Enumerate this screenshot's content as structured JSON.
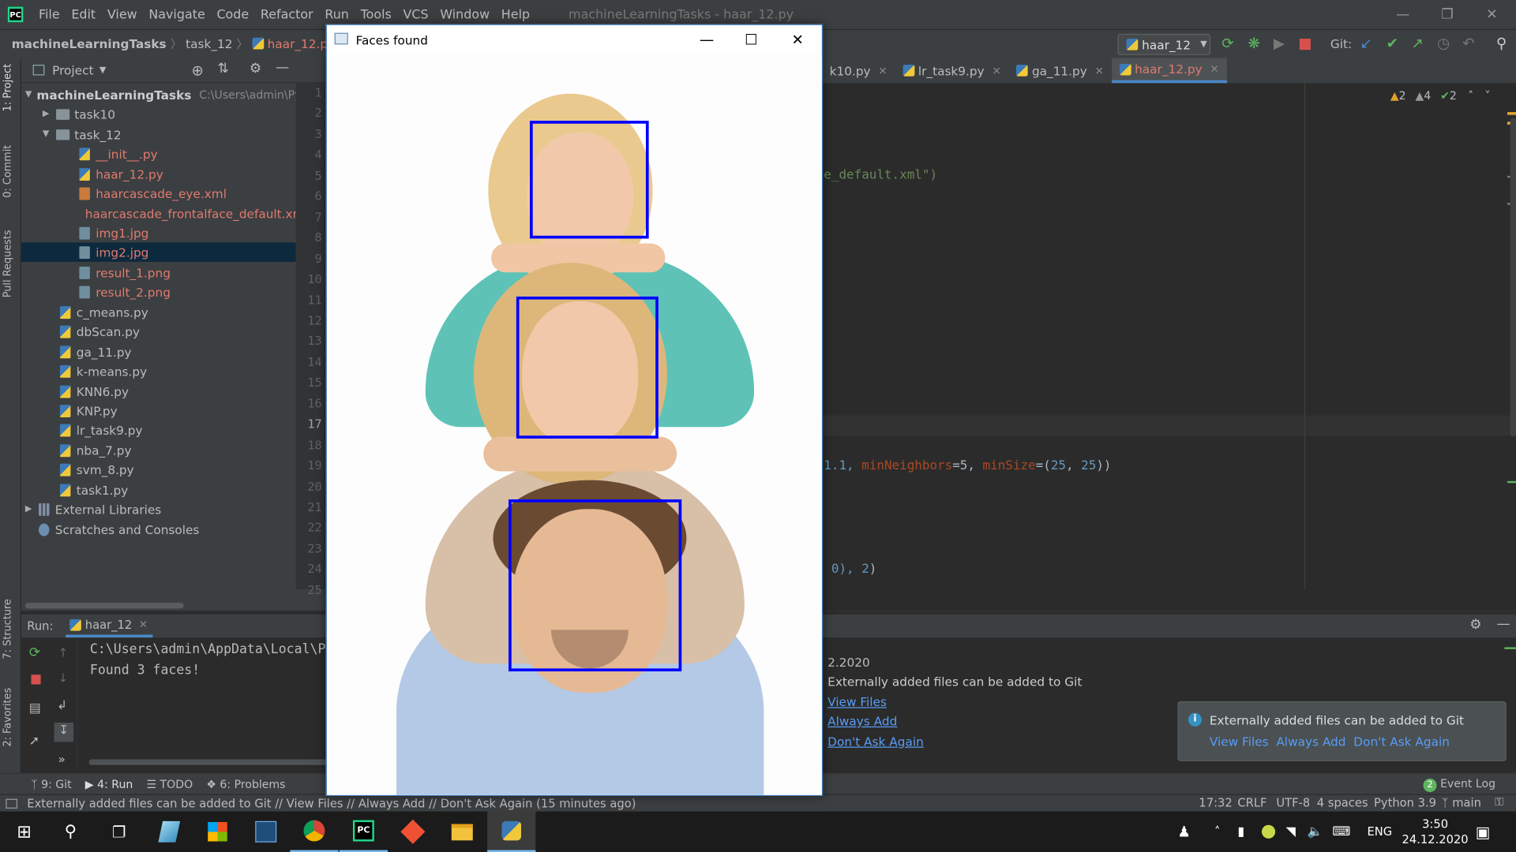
{
  "window": {
    "title": "machineLearningTasks - haar_12.py"
  },
  "menu": [
    "File",
    "Edit",
    "View",
    "Navigate",
    "Code",
    "Refactor",
    "Run",
    "Tools",
    "VCS",
    "Window",
    "Help"
  ],
  "breadcrumb": {
    "project": "machineLearningTasks",
    "folder": "task_12",
    "file": "haar_12.py"
  },
  "toolbar": {
    "run_config": "haar_12",
    "git_label": "Git:"
  },
  "project_panel": {
    "title": "Project",
    "root_name": "machineLearningTasks",
    "root_path": "C:\\Users\\admin\\Pych",
    "items": [
      {
        "name": "task10"
      },
      {
        "name": "task_12"
      },
      {
        "name": "__init__.py"
      },
      {
        "name": "haar_12.py"
      },
      {
        "name": "haarcascade_eye.xml"
      },
      {
        "name": "haarcascade_frontalface_default.xml"
      },
      {
        "name": "img1.jpg"
      },
      {
        "name": "img2.jpg"
      },
      {
        "name": "result_1.png"
      },
      {
        "name": "result_2.png"
      },
      {
        "name": "c_means.py"
      },
      {
        "name": "dbScan.py"
      },
      {
        "name": "ga_11.py"
      },
      {
        "name": "k-means.py"
      },
      {
        "name": "KNN6.py"
      },
      {
        "name": "KNP.py"
      },
      {
        "name": "lr_task9.py"
      },
      {
        "name": "nba_7.py"
      },
      {
        "name": "svm_8.py"
      },
      {
        "name": "task1.py"
      },
      {
        "name": "External Libraries"
      },
      {
        "name": "Scratches and Consoles"
      }
    ]
  },
  "side_tabs": [
    "1: Project",
    "0: Commit",
    "Pull Requests",
    "7: Structure",
    "2: Favorites"
  ],
  "editor_tabs": [
    {
      "label": "k10.py"
    },
    {
      "label": "lr_task9.py"
    },
    {
      "label": "ga_11.py"
    },
    {
      "label": "haar_12.py"
    }
  ],
  "line_numbers": [
    "1",
    "2",
    "3",
    "4",
    "5",
    "6",
    "7",
    "8",
    "9",
    "10",
    "11",
    "12",
    "13",
    "14",
    "15",
    "16",
    "17",
    "18",
    "19",
    "20",
    "21",
    "22",
    "23",
    "24",
    "25"
  ],
  "inspections": {
    "warnings": "2",
    "weak_warnings": "4",
    "ok": "2"
  },
  "code": {
    "line5": "e_default.xml\")",
    "line19_a": "1.1, ",
    "line19_b": "minNeighbors",
    "line19_c": "=5, ",
    "line19_d": "minSize",
    "line19_e": "=(",
    "line19_f": "25",
    "line19_g": ", ",
    "line19_h": "25",
    "line19_i": "))",
    "line24_a": " 0), ",
    "line24_b": "2",
    "line24_c": ")"
  },
  "run_panel": {
    "label": "Run:",
    "tab": "haar_12",
    "console_line1": "C:\\Users\\admin\\AppData\\Local\\P",
    "console_line2": "Found 3 faces!"
  },
  "event_log": {
    "header_fragment": "g",
    "date_fragment": "2.2020",
    "message": "Externally added files can be added to Git",
    "links": [
      "View Files",
      "Always Add",
      "Don't Ask Again"
    ]
  },
  "notification": {
    "message": "Externally added files can be added to Git",
    "links": [
      "View Files",
      "Always Add",
      "Don't Ask Again"
    ]
  },
  "tool_windows": {
    "git": "9: Git",
    "run": "4: Run",
    "todo": "TODO",
    "problems": "6: Problems",
    "event_log": "Event Log",
    "event_count": "2"
  },
  "status_bar": {
    "message": "Externally added files can be added to Git // View Files // Always Add // Don't Ask Again (15 minutes ago)",
    "position": "17:32",
    "line_sep": "CRLF",
    "encoding": "UTF-8",
    "indent": "4 spaces",
    "interpreter": "Python 3.9",
    "branch": "main"
  },
  "dialog": {
    "title": "Faces found",
    "faces_detected": 3
  },
  "taskbar": {
    "language": "ENG",
    "time": "3:50",
    "date": "24.12.2020"
  },
  "colors": {
    "face_box": "#0000ff",
    "accent": "#4a88c7",
    "file_modified": "#e07a6f"
  }
}
